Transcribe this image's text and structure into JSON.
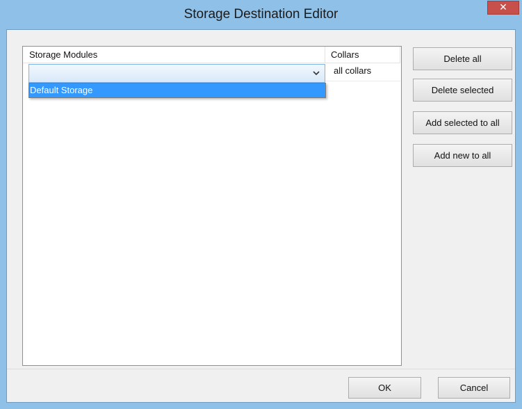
{
  "window": {
    "title": "Storage Destination Editor",
    "close_glyph": "✕"
  },
  "grid": {
    "columns": [
      "Storage Modules",
      "Collars"
    ],
    "rows": [
      {
        "storage_module_value": "",
        "collars": "all collars"
      }
    ],
    "dropdown_options": [
      "Default Storage"
    ],
    "highlighted_option": "Default Storage"
  },
  "buttons": {
    "delete_all": "Delete all",
    "delete_selected": "Delete selected",
    "add_selected_to_all": "Add selected to all",
    "add_new_to_all": "Add new to all",
    "ok": "OK",
    "cancel": "Cancel"
  },
  "icons": {
    "combo_arrow": "chevron-down-icon",
    "close": "close-icon"
  },
  "colors": {
    "titlebar": "#8ec0e8",
    "close_button": "#c7504a",
    "selection": "#3399ff"
  }
}
